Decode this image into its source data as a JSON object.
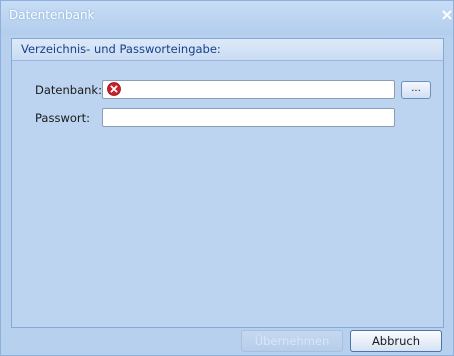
{
  "window": {
    "title": "Datentenbank",
    "close_icon": "close-icon"
  },
  "group": {
    "title": "Verzeichnis- und Passworteingabe:"
  },
  "form": {
    "database_label": "Datenbank:",
    "database_value": "",
    "database_status_icon": "error-icon",
    "browse_label": "...",
    "password_label": "Passwort:",
    "password_value": ""
  },
  "buttons": {
    "accept_label": "Übernehmen",
    "cancel_label": "Abbruch"
  },
  "colors": {
    "window_bg": "#b6d0ee",
    "error_red": "#c8202a"
  }
}
